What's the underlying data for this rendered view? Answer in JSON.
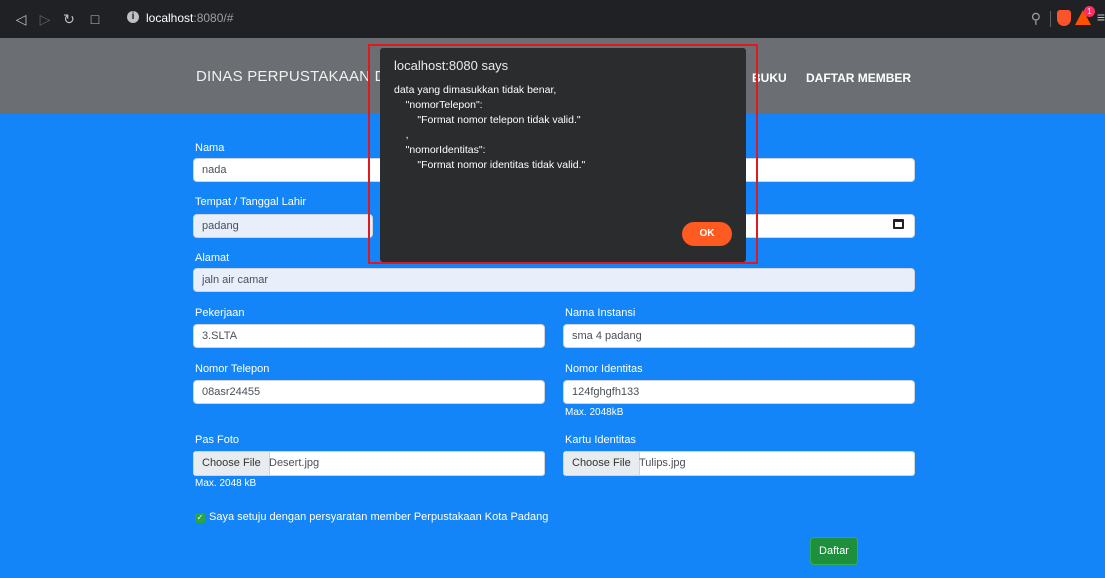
{
  "browser": {
    "url_host": "localhost",
    "url_path": ":8080/#",
    "rewards_badge": "1",
    "icons": [
      "back-icon",
      "forward-icon",
      "reload-icon",
      "bookmark-icon",
      "info-icon",
      "zoom-icon",
      "brave-shield-icon",
      "brave-rewards-icon",
      "menu-icon"
    ]
  },
  "site": {
    "brand": "DINAS PERPUSTAKAAN DA",
    "nav": {
      "buku": "BUKU",
      "daftar_member": "DAFTAR MEMBER"
    }
  },
  "form": {
    "nama": {
      "label": "Nama",
      "value": "nada"
    },
    "tempat_tanggal": {
      "label": "Tempat / Tanggal Lahir",
      "tempat": "padang"
    },
    "alamat": {
      "label": "Alamat",
      "value": "jaln air camar"
    },
    "pekerjaan": {
      "label": "Pekerjaan",
      "value": "3.SLTA"
    },
    "nama_instansi": {
      "label": "Nama Instansi",
      "value": "sma 4 padang"
    },
    "nomor_telepon": {
      "label": "Nomor Telepon",
      "value": "08asr24455"
    },
    "nomor_identitas": {
      "label": "Nomor Identitas",
      "value": "124fghgfh133",
      "helper": "Max. 2048kB"
    },
    "pas_foto": {
      "label": "Pas Foto",
      "button": "Choose File",
      "file": "Desert.jpg",
      "helper": "Max. 2048 kB"
    },
    "kartu_identitas": {
      "label": "Kartu Identitas",
      "button": "Choose File",
      "file": "Tulips.jpg"
    },
    "agree": {
      "checked": true,
      "text": "Saya setuju dengan persyaratan member Perpustakaan Kota Padang"
    },
    "submit": "Daftar"
  },
  "dialog": {
    "title": "localhost:8080 says",
    "message": "data yang dimasukkan tidak benar,\n    \"nomorTelepon\":\n        \"Format nomor telepon tidak valid.\"\n    ,\n    \"nomorIdentitas\":\n        \"Format nomor identitas tidak valid.\"",
    "ok": "OK"
  },
  "colors": {
    "page_bg": "#1485f8",
    "navbar_bg": "#6b6e72",
    "dialog_bg": "#2a2c2e",
    "ok_button": "#ff5a1f",
    "highlight_outline": "#e0191f",
    "submit_button": "#1e8f3c"
  }
}
